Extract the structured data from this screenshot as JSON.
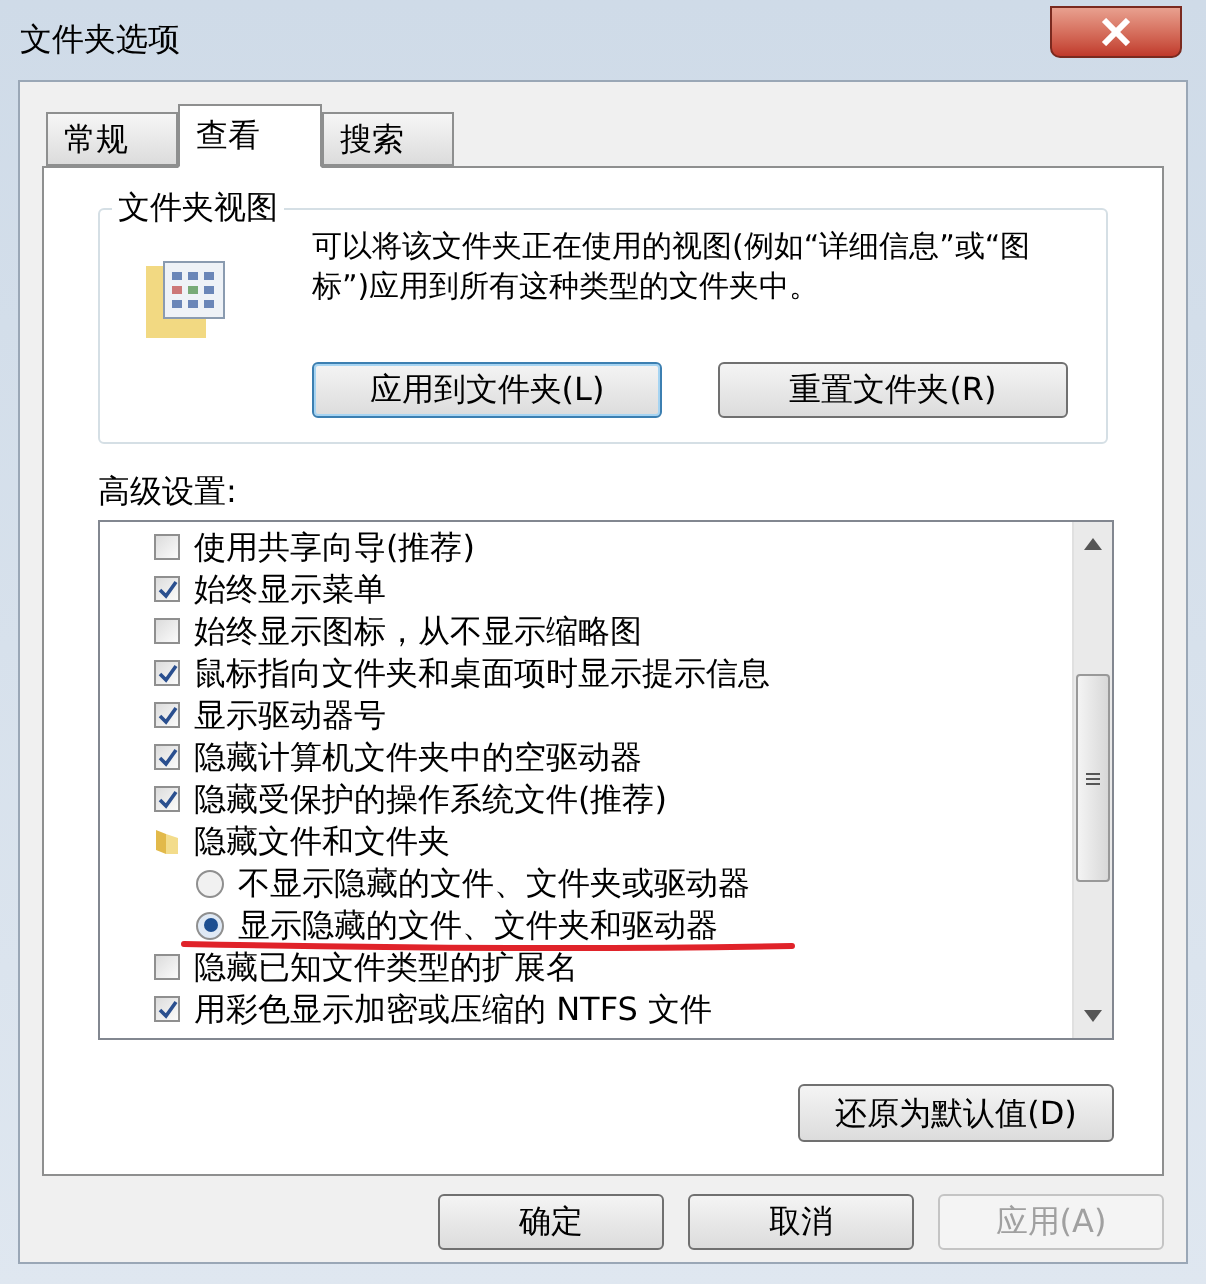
{
  "window": {
    "title": "文件夹选项"
  },
  "tabs": [
    {
      "label": "常规",
      "selected": false
    },
    {
      "label": "查看",
      "selected": true
    },
    {
      "label": "搜索",
      "selected": false
    }
  ],
  "folder_views": {
    "title": "文件夹视图",
    "description": "可以将该文件夹正在使用的视图(例如“详细信息”或“图标”)应用到所有这种类型的文件夹中。",
    "buttons": [
      {
        "label": "应用到文件夹(L)",
        "focused": true
      },
      {
        "label": "重置文件夹(R)",
        "focused": false
      }
    ]
  },
  "advanced": {
    "label": "高级设置:",
    "items": [
      {
        "kind": "checkbox",
        "label": "使用共享向导(推荐)",
        "checked": false
      },
      {
        "kind": "checkbox",
        "label": "始终显示菜单",
        "checked": true
      },
      {
        "kind": "checkbox",
        "label": "始终显示图标，从不显示缩略图",
        "checked": false
      },
      {
        "kind": "checkbox",
        "label": "鼠标指向文件夹和桌面项时显示提示信息",
        "checked": true
      },
      {
        "kind": "checkbox",
        "label": "显示驱动器号",
        "checked": true
      },
      {
        "kind": "checkbox",
        "label": "隐藏计算机文件夹中的空驱动器",
        "checked": true
      },
      {
        "kind": "checkbox",
        "label": "隐藏受保护的操作系统文件(推荐)",
        "checked": true
      },
      {
        "kind": "folder",
        "label": "隐藏文件和文件夹",
        "children": [
          {
            "kind": "radio",
            "label": "不显示隐藏的文件、文件夹或驱动器",
            "selected": false
          },
          {
            "kind": "radio",
            "label": "显示隐藏的文件、文件夹和驱动器",
            "selected": true
          }
        ]
      },
      {
        "kind": "checkbox",
        "label": "隐藏已知文件类型的扩展名",
        "checked": false
      },
      {
        "kind": "checkbox",
        "label": "用彩色显示加密或压缩的 NTFS 文件",
        "checked": true
      }
    ],
    "restore_button": "还原为默认值(D)"
  },
  "buttons": [
    {
      "label": "确定",
      "disabled": false
    },
    {
      "label": "取消",
      "disabled": false
    },
    {
      "label": "应用(A)",
      "disabled": true
    }
  ]
}
